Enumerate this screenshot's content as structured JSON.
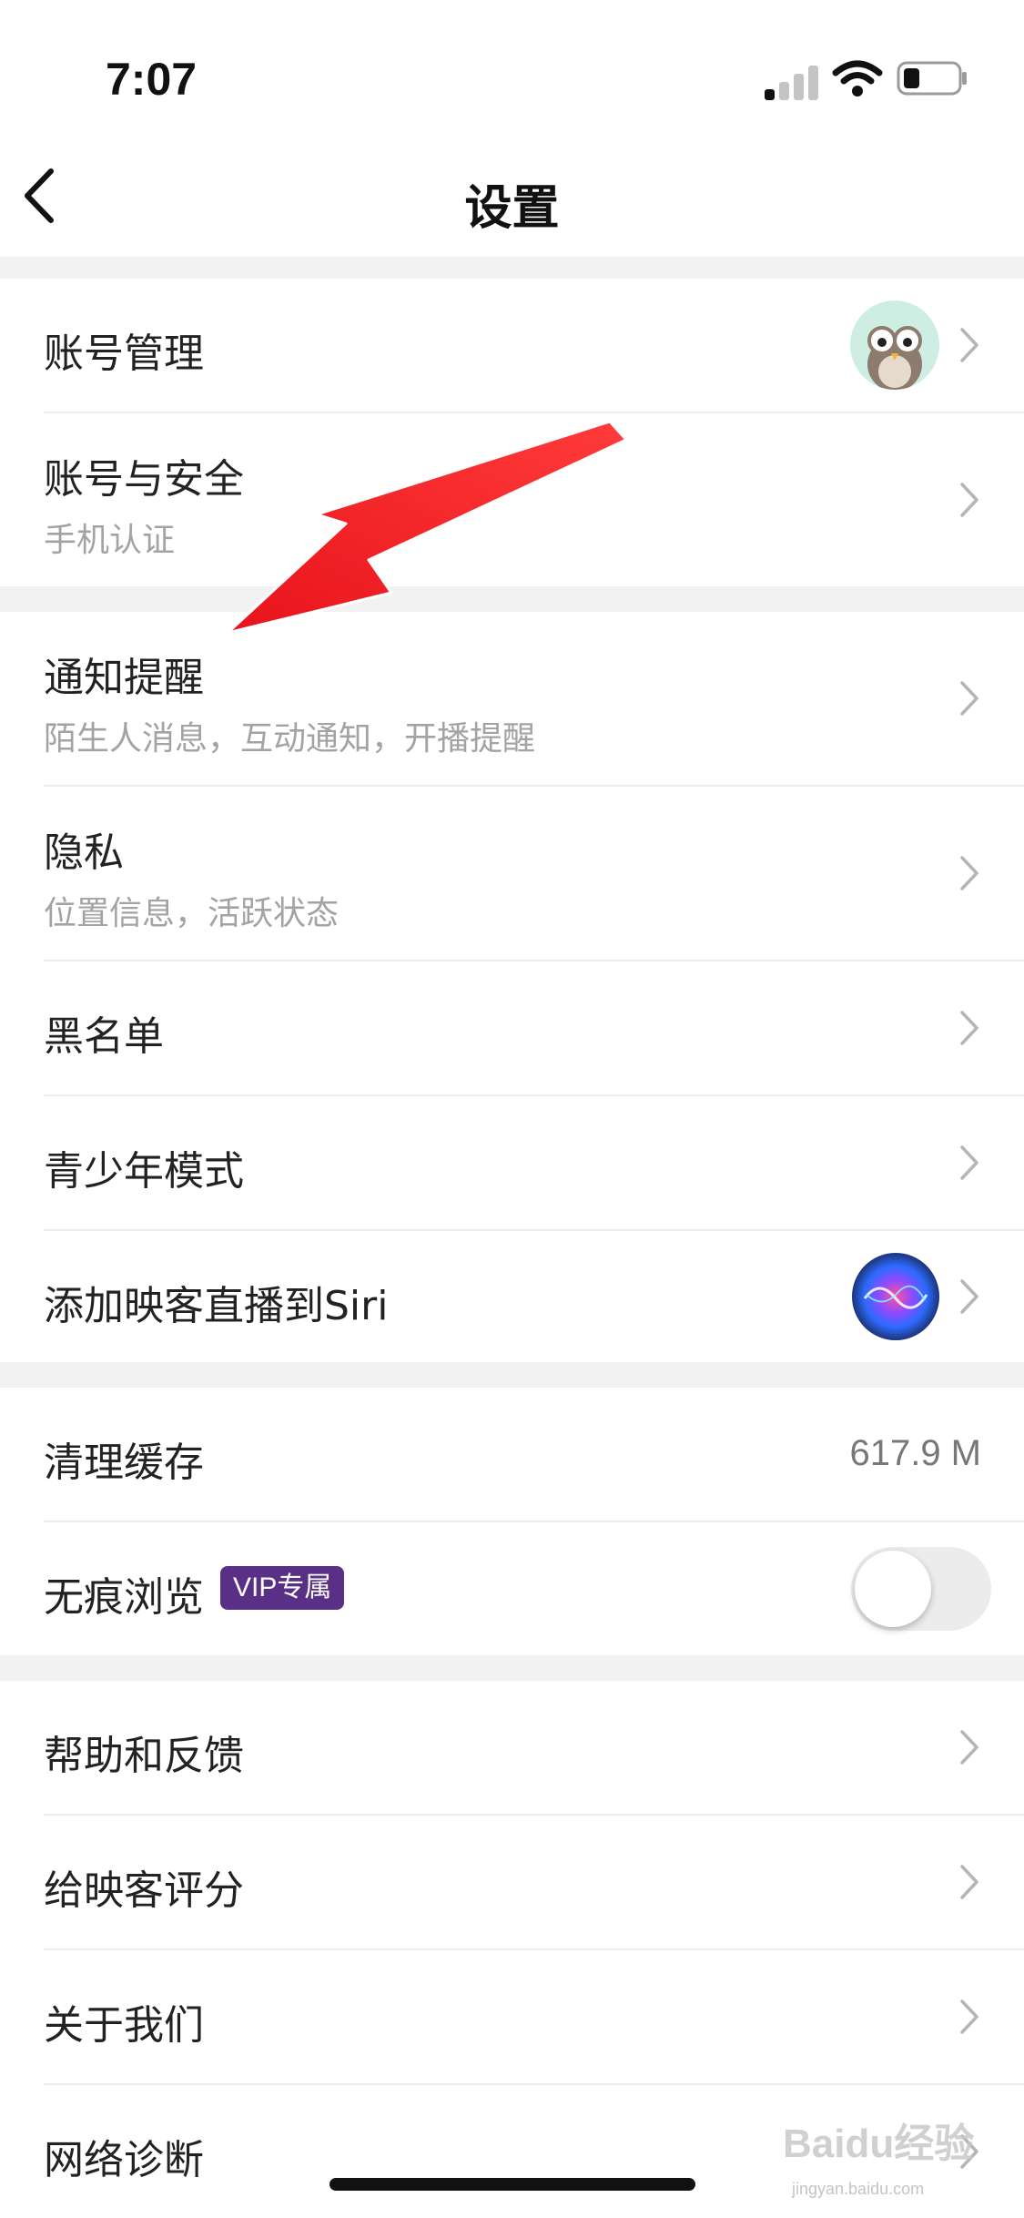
{
  "status_bar": {
    "time": "7:07",
    "signal_icon": "cellular-signal-icon",
    "wifi_icon": "wifi-icon",
    "battery_icon": "battery-icon",
    "battery_level": 0.3
  },
  "nav": {
    "back_icon": "chevron-left-icon",
    "title": "设置"
  },
  "group1": {
    "account_manage": {
      "title": "账号管理",
      "avatar_icon": "owl-avatar-icon"
    },
    "account_security": {
      "title": "账号与安全",
      "subtitle": "手机认证"
    }
  },
  "group2": {
    "notifications": {
      "title": "通知提醒",
      "subtitle": "陌生人消息，互动通知，开播提醒"
    },
    "privacy": {
      "title": "隐私",
      "subtitle": "位置信息，活跃状态"
    },
    "blacklist": {
      "title": "黑名单"
    },
    "teen_mode": {
      "title": "青少年模式"
    },
    "siri": {
      "title": "添加映客直播到Siri",
      "icon": "siri-icon"
    }
  },
  "group3": {
    "clear_cache": {
      "title": "清理缓存",
      "value": "617.9 M"
    },
    "incognito": {
      "title": "无痕浏览",
      "badge": "VIP专属",
      "toggle_on": false
    }
  },
  "group4": {
    "help": {
      "title": "帮助和反馈"
    },
    "rate": {
      "title": "给映客评分"
    },
    "about": {
      "title": "关于我们"
    },
    "network": {
      "title": "网络诊断"
    }
  },
  "annotation": {
    "icon": "red-arrow-icon",
    "color": "#e8141b"
  },
  "watermark": {
    "text": "Baidu经验",
    "sub": "jingyan.baidu.com"
  },
  "colors": {
    "background": "#f2f2f2",
    "surface": "#ffffff",
    "vip_badge": "#5a2f86",
    "subtitle_text": "#a3a3a3"
  }
}
